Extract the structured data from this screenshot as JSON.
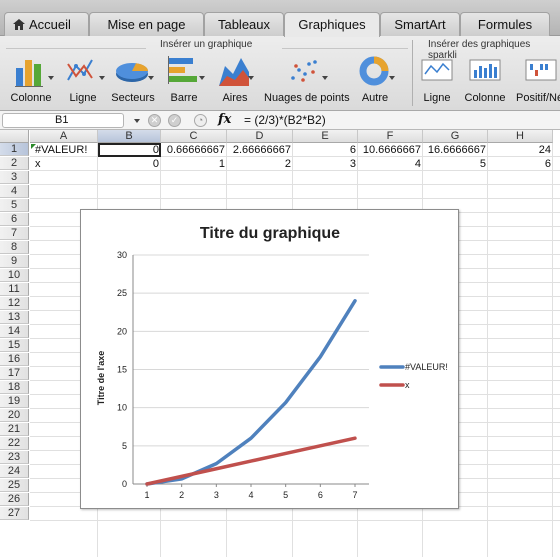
{
  "tabs": [
    "Accueil",
    "Mise en page",
    "Tableaux",
    "Graphiques",
    "SmartArt",
    "Formules"
  ],
  "ribbon": {
    "group_insert_chart": "Insérer un graphique",
    "group_sparklines": "Insérer des graphiques sparkli",
    "buttons": [
      "Colonne",
      "Ligne",
      "Secteurs",
      "Barre",
      "Aires",
      "Nuages de points",
      "Autre"
    ],
    "sparkline_buttons": [
      "Ligne",
      "Colonne",
      "Positif/Né"
    ]
  },
  "formula_bar": {
    "name_box": "B1",
    "fx": "fx",
    "formula": "= (2/3)*(B2*B2)"
  },
  "columns": [
    "A",
    "B",
    "C",
    "D",
    "E",
    "F",
    "G",
    "H"
  ],
  "rows": [
    "1",
    "2",
    "3",
    "4",
    "5",
    "6",
    "7",
    "8",
    "9",
    "10",
    "11",
    "12",
    "13",
    "14",
    "15",
    "16",
    "17",
    "18",
    "19",
    "20",
    "21",
    "22",
    "23",
    "24",
    "25",
    "26",
    "27"
  ],
  "cells": {
    "row1": [
      "#VALEUR!",
      "0",
      "0.66666667",
      "2.66666667",
      "6",
      "10.6666667",
      "16.6666667",
      "24"
    ],
    "row2": [
      "x",
      "0",
      "1",
      "2",
      "3",
      "4",
      "5",
      "6"
    ]
  },
  "colors": {
    "series1": "#4f81bd",
    "series2": "#c0504d",
    "selection": "#222222"
  },
  "chart_data": {
    "type": "line",
    "title": "Titre du graphique",
    "ylabel": "Titre de l'axe",
    "categories": [
      "1",
      "2",
      "3",
      "4",
      "5",
      "6",
      "7"
    ],
    "ylim": [
      0,
      30
    ],
    "yticks": [
      "0",
      "5",
      "10",
      "15",
      "20",
      "25",
      "30"
    ],
    "grid": true,
    "legend": "right",
    "series": [
      {
        "name": "#VALEUR!",
        "values": [
          0,
          0.66666667,
          2.66666667,
          6,
          10.6666667,
          16.6666667,
          24
        ]
      },
      {
        "name": "x",
        "values": [
          0,
          1,
          2,
          3,
          4,
          5,
          6
        ]
      }
    ]
  }
}
